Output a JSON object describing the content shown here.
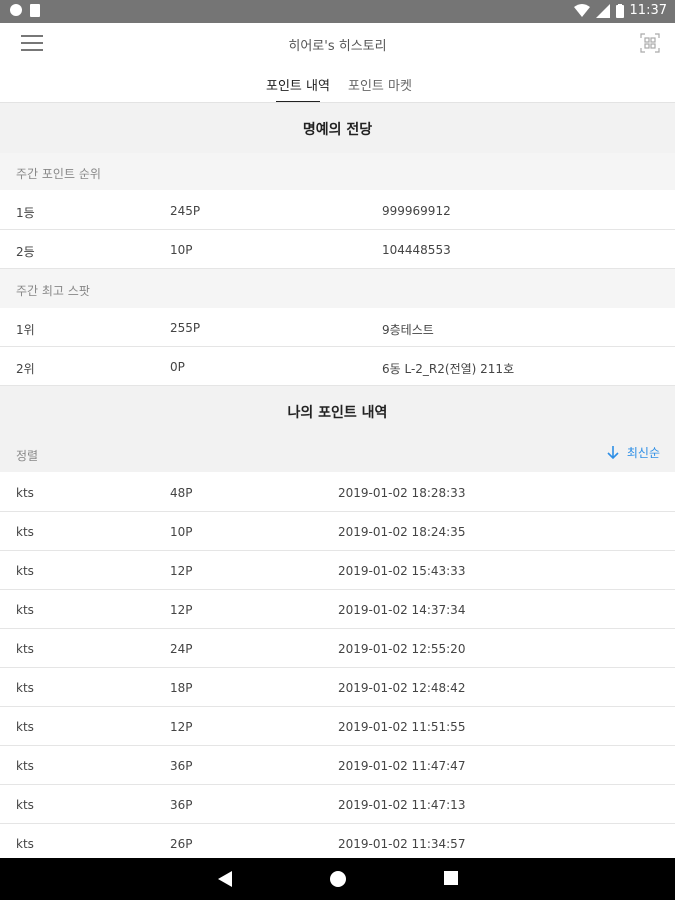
{
  "status_bar": {
    "time": "11:37"
  },
  "header": {
    "title": "히어로's 히스토리"
  },
  "tabs": [
    {
      "label": "포인트 내역"
    },
    {
      "label": "포인트 마켓"
    }
  ],
  "hall_of_fame": {
    "title": "명예의 전당",
    "weekly_rank": {
      "header": "주간 포인트 순위",
      "rows": [
        {
          "rank": "1등",
          "points": "245P",
          "name": "999969912"
        },
        {
          "rank": "2등",
          "points": "10P",
          "name": "104448553"
        }
      ]
    },
    "weekly_spot": {
      "header": "주간 최고 스팟",
      "rows": [
        {
          "rank": "1위",
          "points": "255P",
          "name": "9층테스트"
        },
        {
          "rank": "2위",
          "points": "0P",
          "name": "6동 L-2_R2(전열) 211호"
        }
      ]
    }
  },
  "my_points": {
    "title": "나의 포인트 내역",
    "sort_label": "정렬",
    "sort_value": "최신순",
    "rows": [
      {
        "user": "kts",
        "points": "48P",
        "time": "2019-01-02 18:28:33"
      },
      {
        "user": "kts",
        "points": "10P",
        "time": "2019-01-02 18:24:35"
      },
      {
        "user": "kts",
        "points": "12P",
        "time": "2019-01-02 15:43:33"
      },
      {
        "user": "kts",
        "points": "12P",
        "time": "2019-01-02 14:37:34"
      },
      {
        "user": "kts",
        "points": "24P",
        "time": "2019-01-02 12:55:20"
      },
      {
        "user": "kts",
        "points": "18P",
        "time": "2019-01-02 12:48:42"
      },
      {
        "user": "kts",
        "points": "12P",
        "time": "2019-01-02 11:51:55"
      },
      {
        "user": "kts",
        "points": "36P",
        "time": "2019-01-02 11:47:47"
      },
      {
        "user": "kts",
        "points": "36P",
        "time": "2019-01-02 11:47:13"
      },
      {
        "user": "kts",
        "points": "26P",
        "time": "2019-01-02 11:34:57"
      }
    ]
  },
  "colors": {
    "accent": "#2e8fe6",
    "band": "#f2f2f2",
    "status_bar": "#757575"
  }
}
